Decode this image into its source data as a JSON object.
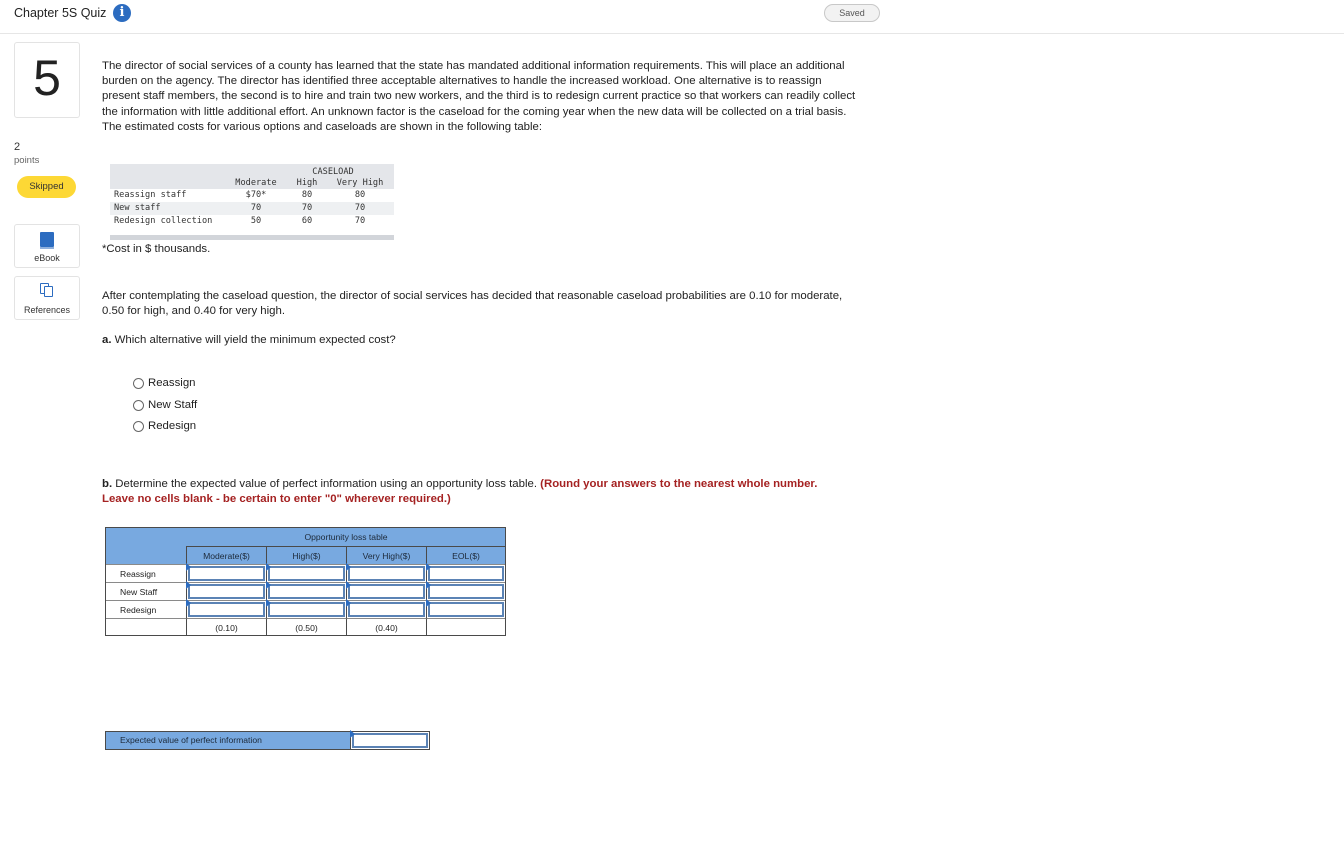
{
  "header": {
    "title": "Chapter 5S Quiz",
    "info_icon": "info-icon",
    "saved": "Saved"
  },
  "question": {
    "number": "5",
    "points_value": "2",
    "points_label": "points",
    "status": "Skipped"
  },
  "rail": {
    "ebook": "eBook",
    "references": "References",
    "ebook_icon": "book-icon",
    "references_icon": "copy-icon"
  },
  "body": {
    "intro": "The director of social services of a county has learned that the state has mandated additional information requirements. This will place an additional burden on the agency. The director has identified three acceptable alternatives to handle the increased workload. One alternative is to reassign present staff members, the second is to hire and train two new workers, and the third is to redesign current practice so that workers can readily collect the information with little additional effort. An unknown factor is the caseload for the coming year when the new data will be collected on a trial basis. The estimated costs for various options and caseloads are shown in the following table:",
    "cost_note": "*Cost in $ thousands.",
    "after": "After contemplating the caseload question, the director of social services has decided that reasonable caseload probabilities are 0.10 for moderate, 0.50 for high, and 0.40 for very high.",
    "part_a_label": "a.",
    "part_a_text": "Which alternative will yield the minimum expected cost?",
    "options": [
      "Reassign",
      "New Staff",
      "Redesign"
    ],
    "part_b_label": "b.",
    "part_b_text": "Determine the expected value of perfect information using an opportunity loss table.",
    "part_b_instruction": "(Round your answers to the nearest whole number. Leave no cells blank - be certain to enter \"0\" wherever required.)"
  },
  "caseload_table": {
    "caption": "CASELOAD",
    "columns": [
      "Moderate",
      "High",
      "Very High"
    ],
    "rows": [
      {
        "label": "Reassign staff",
        "values": [
          "$70*",
          "80",
          "80"
        ]
      },
      {
        "label": "New staff",
        "values": [
          "70",
          "70",
          "70"
        ]
      },
      {
        "label": "Redesign collection",
        "values": [
          "50",
          "60",
          "70"
        ]
      }
    ]
  },
  "opportunity_table": {
    "caption": "Opportunity loss table",
    "columns": [
      "Moderate($)",
      "High($)",
      "Very High($)",
      "EOL($)"
    ],
    "rows": [
      "Reassign",
      "New Staff",
      "Redesign"
    ],
    "probabilities": [
      "(0.10)",
      "(0.50)",
      "(0.40)"
    ]
  },
  "evpi": {
    "label": "Expected value of perfect information",
    "value": ""
  }
}
